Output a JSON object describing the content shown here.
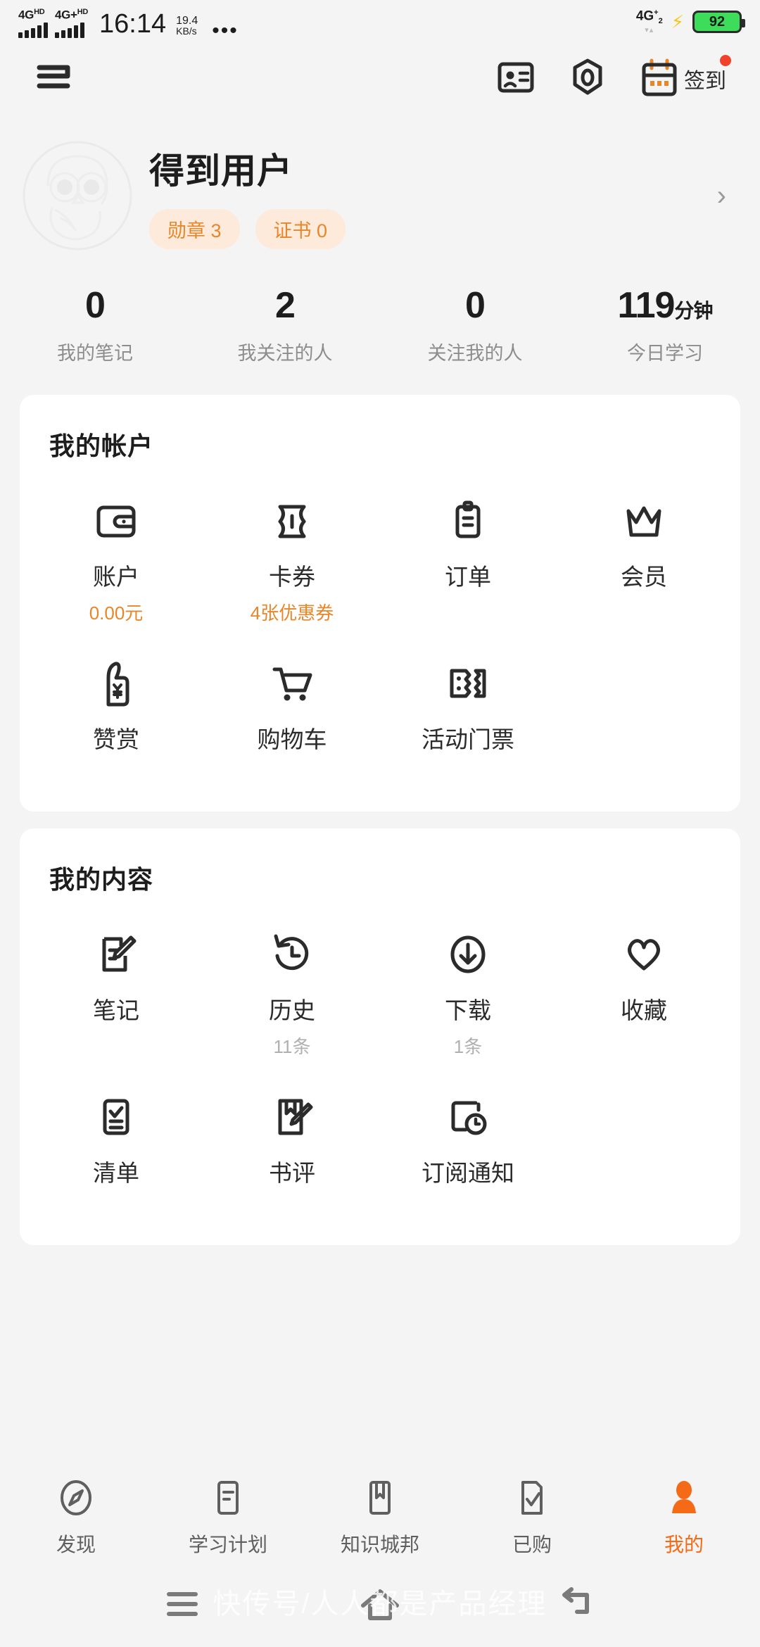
{
  "statusbar": {
    "sim1_label": "4G",
    "sim1_sup": "HD",
    "sim2_label": "4G+",
    "sim2_sup": "HD",
    "time": "16:14",
    "netspeed_value": "19.4",
    "netspeed_unit": "KB/s",
    "overflow": "•••",
    "data_label": "4G",
    "data_sup": "+",
    "data_sub": "2",
    "arrows": "▾▴",
    "charging_icon": "bolt-icon",
    "battery_level": "92"
  },
  "appbar": {
    "menu_icon": "menu-icon",
    "idcard_icon": "id-card-icon",
    "hexagon_icon": "hexagon-eye-icon",
    "calendar_icon": "calendar-icon",
    "checkin_label": "签到",
    "badge_icon": "red-dot-badge"
  },
  "profile": {
    "avatar_icon": "owl-avatar-icon",
    "username": "得到用户",
    "chips": [
      {
        "label": "勋章 3"
      },
      {
        "label": "证书 0"
      }
    ],
    "chevron_icon": "chevron-right-icon"
  },
  "stats": [
    {
      "value": "0",
      "unit": "",
      "label": "我的笔记"
    },
    {
      "value": "2",
      "unit": "",
      "label": "我关注的人"
    },
    {
      "value": "0",
      "unit": "",
      "label": "关注我的人"
    },
    {
      "value": "119",
      "unit": "分钟",
      "label": "今日学习"
    }
  ],
  "account_card": {
    "title": "我的帐户",
    "items": [
      {
        "icon": "wallet-icon",
        "label": "账户",
        "sub": "0.00元",
        "sub_style": "orange"
      },
      {
        "icon": "coupon-ticket-icon",
        "label": "卡券",
        "sub": "4张优惠券",
        "sub_style": "orange"
      },
      {
        "icon": "clipboard-icon",
        "label": "订单",
        "sub": "",
        "sub_style": "none"
      },
      {
        "icon": "crown-icon",
        "label": "会员",
        "sub": "",
        "sub_style": "none"
      },
      {
        "icon": "thumbup-yen-icon",
        "label": "赞赏",
        "sub": "",
        "sub_style": "none"
      },
      {
        "icon": "shopping-cart-icon",
        "label": "购物车",
        "sub": "",
        "sub_style": "none"
      },
      {
        "icon": "event-ticket-icon",
        "label": "活动门票",
        "sub": "",
        "sub_style": "none"
      }
    ]
  },
  "content_card": {
    "title": "我的内容",
    "items": [
      {
        "icon": "note-edit-icon",
        "label": "笔记",
        "sub": "",
        "sub_style": "none"
      },
      {
        "icon": "history-clock-icon",
        "label": "历史",
        "sub": "11条",
        "sub_style": "gray"
      },
      {
        "icon": "download-icon",
        "label": "下载",
        "sub": "1条",
        "sub_style": "gray"
      },
      {
        "icon": "heart-icon",
        "label": "收藏",
        "sub": "",
        "sub_style": "none"
      },
      {
        "icon": "checklist-icon",
        "label": "清单",
        "sub": "",
        "sub_style": "none"
      },
      {
        "icon": "book-review-icon",
        "label": "书评",
        "sub": "",
        "sub_style": "none"
      },
      {
        "icon": "subscribe-bell-icon",
        "label": "订阅通知",
        "sub": "",
        "sub_style": "none"
      }
    ]
  },
  "bottomnav": {
    "items": [
      {
        "icon": "compass-icon",
        "label": "发现",
        "active": false
      },
      {
        "icon": "plan-icon",
        "label": "学习计划",
        "active": false
      },
      {
        "icon": "bookmark-icon",
        "label": "知识城邦",
        "active": false
      },
      {
        "icon": "purchased-icon",
        "label": "已购",
        "active": false
      },
      {
        "icon": "person-icon",
        "label": "我的",
        "active": true
      }
    ]
  },
  "sysbar": {
    "recents_icon": "recents-icon",
    "home_icon": "home-icon",
    "back_icon": "back-icon"
  },
  "watermark": "快传号/人人都是产品经理",
  "colors": {
    "accent": "#f56a16",
    "chip_bg": "#fdeada",
    "chip_text": "#e8862a",
    "page_bg": "#f4f4f4",
    "card_bg": "#ffffff",
    "battery_green": "#3ddc5b",
    "badge_red": "#f0422b"
  }
}
